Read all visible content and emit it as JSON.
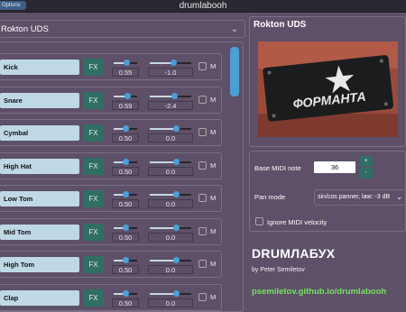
{
  "window": {
    "title": "drumlabooh",
    "options_label": "Options"
  },
  "kit_selector": {
    "value": "Rokton UDS"
  },
  "instruments": [
    {
      "name": "Kick",
      "fx": "FX",
      "gain": "0.55",
      "gain_frac": 0.55,
      "pan": "-1.0",
      "pan_frac": 0.56,
      "mute": "M"
    },
    {
      "name": "Snare",
      "fx": "FX",
      "gain": "0.59",
      "gain_frac": 0.59,
      "pan": "-2.4",
      "pan_frac": 0.58,
      "mute": "M"
    },
    {
      "name": "Cymbal",
      "fx": "FX",
      "gain": "0.50",
      "gain_frac": 0.5,
      "pan": "0.0",
      "pan_frac": 0.64,
      "mute": "M"
    },
    {
      "name": "High Hat",
      "fx": "FX",
      "gain": "0.50",
      "gain_frac": 0.5,
      "pan": "0.0",
      "pan_frac": 0.64,
      "mute": "M"
    },
    {
      "name": "Low Tom",
      "fx": "FX",
      "gain": "0.50",
      "gain_frac": 0.5,
      "pan": "0.0",
      "pan_frac": 0.64,
      "mute": "M"
    },
    {
      "name": "Mid Tom",
      "fx": "FX",
      "gain": "0.50",
      "gain_frac": 0.5,
      "pan": "0.0",
      "pan_frac": 0.64,
      "mute": "M"
    },
    {
      "name": "High Tom",
      "fx": "FX",
      "gain": "0.50",
      "gain_frac": 0.5,
      "pan": "0.0",
      "pan_frac": 0.64,
      "mute": "M"
    },
    {
      "name": "Clap",
      "fx": "FX",
      "gain": "0.50",
      "gain_frac": 0.5,
      "pan": "0.0",
      "pan_frac": 0.64,
      "mute": "M"
    }
  ],
  "kit_info": {
    "title": "Rokton UDS",
    "image_text": "ФОРМАНТА"
  },
  "settings": {
    "midi_note_label": "Base MIDI note",
    "midi_note_value": "36",
    "plus": "+",
    "minus": "-",
    "pan_mode_label": "Pan mode",
    "pan_mode_value": "sin/cos panner, law: -3 dB",
    "ignore_velocity_label": "Ignore MIDI velocity"
  },
  "about": {
    "brand": "DRUMЛАБУХ",
    "author": "by Peter Semiletov",
    "link": "psemiletov.github.io/drumlabooh"
  },
  "colors": {
    "background": "#5d5068",
    "accent": "#4aa0d8",
    "fx": "#2f6f63",
    "link": "#76e262"
  }
}
